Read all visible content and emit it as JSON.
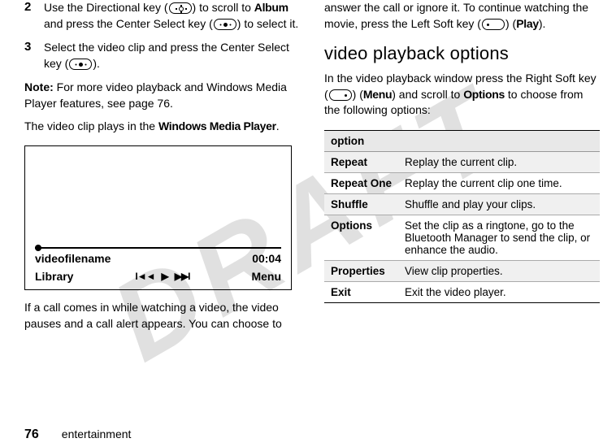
{
  "watermark": "DRAFT",
  "left": {
    "step2_num": "2",
    "step2_a": "Use the Directional key (",
    "step2_b": ") to scroll to ",
    "step2_album": "Album",
    "step2_c": " and press the Center Select key (",
    "step2_d": ") to select it.",
    "step3_num": "3",
    "step3_a": "Select the video clip and press the Center Select key (",
    "step3_b": ").",
    "note_label": "Note:",
    "note_body": " For more video playback and Windows Media Player features, see page 76.",
    "clipplays_a": "The video clip plays in the ",
    "clipplays_wmp": "Windows Media Player",
    "clipplays_b": ".",
    "player": {
      "filename": "videofilename",
      "time": "00:04",
      "left_soft": "Library",
      "ctrl_prev": "I◄◄",
      "ctrl_play": "▶",
      "ctrl_next": "▶▶I",
      "right_soft": "Menu"
    },
    "tail": "If a call comes in while watching a video, the video pauses and a call alert appears. You can choose to"
  },
  "right": {
    "cont_a": "answer the call or ignore it. To continue watching the movie, press the Left Soft key (",
    "cont_b": ") (",
    "cont_play": "Play",
    "cont_c": ").",
    "heading": "video playback options",
    "intro_a": "In the video playback window press the Right Soft key (",
    "intro_b": ") (",
    "intro_menu": "Menu",
    "intro_c": ") and scroll to ",
    "intro_options": "Options",
    "intro_d": " to choose from the following options:",
    "th": "option",
    "rows": [
      {
        "name": "Repeat",
        "desc": "Replay the current clip."
      },
      {
        "name": "Repeat One",
        "desc": "Replay the current clip one time."
      },
      {
        "name": "Shuffle",
        "desc": "Shuffle and play your clips."
      },
      {
        "name": "Options",
        "desc": "Set the clip as a ringtone, go to the Bluetooth Manager to send the clip, or enhance the audio."
      },
      {
        "name": "Properties",
        "desc": "View clip properties."
      },
      {
        "name": "Exit",
        "desc": "Exit the video player."
      }
    ]
  },
  "footer": {
    "page": "76",
    "section": "entertainment"
  }
}
